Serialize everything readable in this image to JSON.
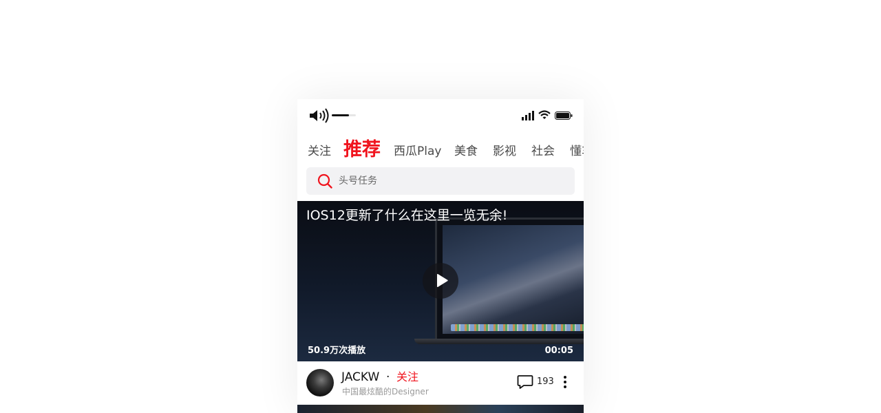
{
  "status_bar": {
    "volume_level": 0.7,
    "icons": [
      "volume-icon",
      "signal-icon",
      "wifi-icon",
      "battery-icon"
    ]
  },
  "tabs": [
    {
      "label": "关注",
      "active": false
    },
    {
      "label": "推荐",
      "active": true
    },
    {
      "label": "西瓜Play",
      "active": false
    },
    {
      "label": "美食",
      "active": false
    },
    {
      "label": "影视",
      "active": false
    },
    {
      "label": "社会",
      "active": false
    },
    {
      "label": "懂车",
      "active": false
    }
  ],
  "search": {
    "placeholder": "头号任务"
  },
  "video": {
    "title": "IOS12更新了什么在这里一览无余!",
    "views": "50.9万次播放",
    "duration": "00:05"
  },
  "author": {
    "name": "JACKW",
    "separator": "·",
    "follow_label": "关注",
    "description": "中国最炫酷的Designer",
    "comment_count": "193"
  },
  "colors": {
    "accent": "#f0141e",
    "search_bg": "#f2f2f4",
    "text_primary": "#111111",
    "text_secondary": "#999999"
  }
}
